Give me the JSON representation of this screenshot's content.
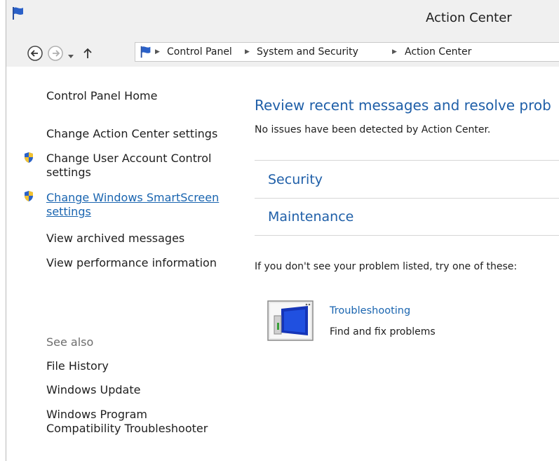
{
  "window": {
    "title": "Action Center"
  },
  "nav": {
    "breadcrumb": [
      "Control Panel",
      "System and Security",
      "Action Center"
    ]
  },
  "sidebar": {
    "home": "Control Panel Home",
    "links": [
      {
        "label": "Change Action Center settings",
        "shield": false
      },
      {
        "label_line1": "Change User Account Control",
        "label_line2": "settings",
        "shield": true
      },
      {
        "label_line1": "Change Windows SmartScreen",
        "label_line2": "settings",
        "shield": true
      },
      {
        "label": "View archived messages",
        "shield": false
      },
      {
        "label": "View performance information",
        "shield": false
      }
    ],
    "see_also": {
      "heading": "See also",
      "items": [
        "File History",
        "Windows Update"
      ],
      "compat_line1": "Windows Program",
      "compat_line2": "Compatibility Troubleshooter"
    }
  },
  "main": {
    "heading": "Review recent messages and resolve prob",
    "status": "No issues have been detected by Action Center.",
    "sections": [
      "Security",
      "Maintenance"
    ],
    "prompt": "If you don't see your problem listed, try one of these:",
    "troubleshooting": {
      "title": "Troubleshooting",
      "desc": "Find and fix problems"
    }
  },
  "colors": {
    "link": "#1a65b0",
    "heading": "#1f5fa8",
    "chrome": "#f0f0f0"
  },
  "icons": [
    "flag-icon",
    "back-icon",
    "forward-icon",
    "dropdown-icon",
    "up-icon",
    "shield-icon",
    "troubleshooting-icon"
  ]
}
